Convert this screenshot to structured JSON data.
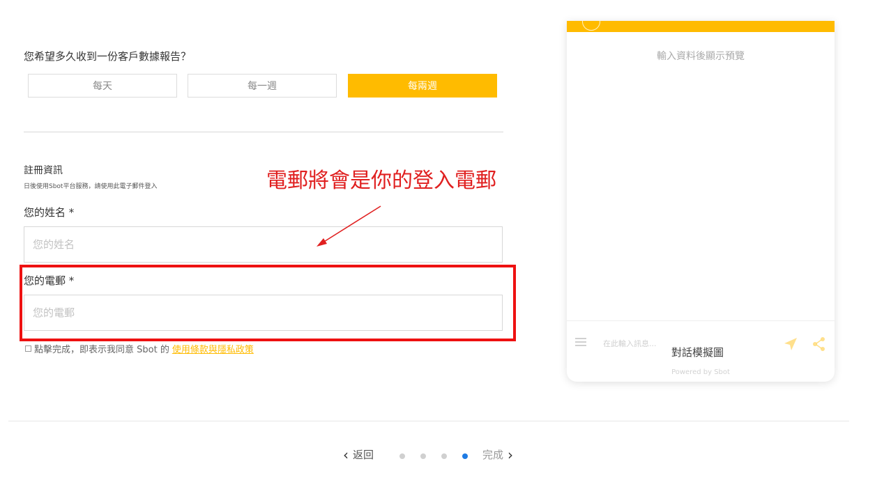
{
  "report_question": "您希望多久收到一份客戶數據報告？",
  "frequency_options": [
    "每天",
    "每一週",
    "每兩週"
  ],
  "frequency_selected": "每兩週",
  "registration": {
    "title": "註冊資訊",
    "subtitle": "日後使用Sbot平台服務，請使用此電子郵件登入"
  },
  "name_field": {
    "label": "您的姓名 *",
    "placeholder": "您的姓名",
    "value": ""
  },
  "email_field": {
    "label": "您的電郵 *",
    "placeholder": "您的電郵",
    "value": ""
  },
  "agreement": {
    "text": "點擊完成，即表示我同意 Sbot 的",
    "link": "使用條款與隱私政策"
  },
  "annotation": {
    "text": "電郵將會是你的登入電郵",
    "color": "#e02020"
  },
  "preview": {
    "hint": "輸入資料後顯示預覽",
    "input_placeholder": "在此輸入訊息...",
    "caption": "對話模擬圖",
    "powered_by": "Powered by Sbot"
  },
  "nav": {
    "back": "返回",
    "next": "完成",
    "step_count": 4,
    "current_step": 4
  },
  "colors": {
    "accent": "#ffbb00",
    "highlight": "#ee1111",
    "step_active": "#1e7be4"
  },
  "icons": [
    "menu-icon",
    "send-icon",
    "share-icon",
    "chevron-left-icon",
    "chevron-right-icon"
  ]
}
